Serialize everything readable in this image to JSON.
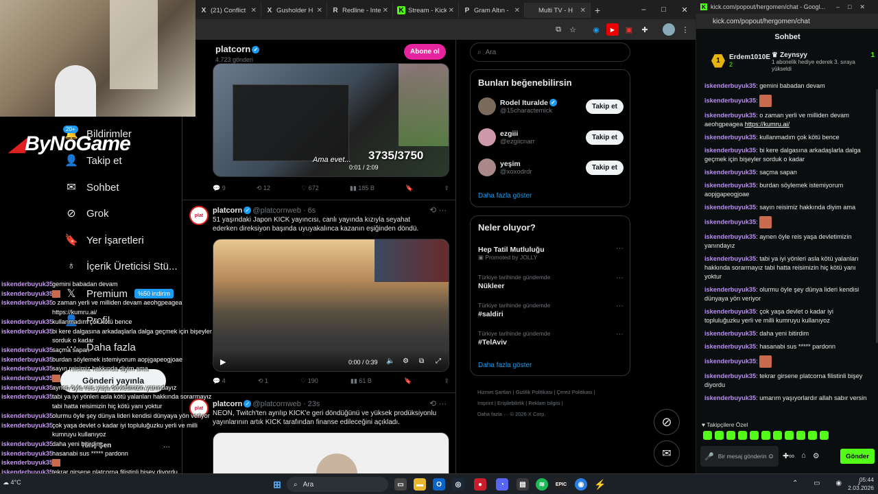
{
  "browser": {
    "tabs": [
      {
        "label": "",
        "icon": "X"
      },
      {
        "label": "",
        "icon": "X"
      },
      {
        "label": "",
        "icon": "X"
      },
      {
        "label": "(21) Conflict",
        "icon": "X"
      },
      {
        "label": "Gusholder H",
        "icon": "X"
      },
      {
        "label": "Redline - Inte",
        "icon": "R"
      },
      {
        "label": "Stream - Kick",
        "icon": "K"
      },
      {
        "label": "Gram Altın -",
        "icon": "P"
      },
      {
        "label": "Multi TV - H",
        "icon": ""
      }
    ],
    "new_tab": "+",
    "window_controls": [
      "–",
      "□",
      "✕"
    ]
  },
  "xnav": {
    "items": [
      {
        "label": "Bildirimler",
        "icon": "bell-icon",
        "glyph": "🔔"
      },
      {
        "label": "Takip et",
        "icon": "add-user-icon",
        "glyph": "👤"
      },
      {
        "label": "Sohbet",
        "icon": "mail-icon",
        "glyph": "✉"
      },
      {
        "label": "Grok",
        "icon": "grok-icon",
        "glyph": "⊘"
      },
      {
        "label": "Yer İşaretleri",
        "icon": "bookmark-icon",
        "glyph": "🔖"
      },
      {
        "label": "İçerik Üreticisi Stü...",
        "icon": "creator-icon",
        "glyph": "♁"
      },
      {
        "label": "Premium",
        "icon": "x-logo-icon",
        "glyph": "𝕏"
      },
      {
        "label": "Profil",
        "icon": "profile-icon",
        "glyph": "👤"
      },
      {
        "label": "Daha fazla",
        "icon": "more-icon",
        "glyph": "⋯"
      }
    ],
    "premium_badge": "%50 indirim",
    "notif_badge": "20+",
    "post_button": "Gönderi yayınla",
    "account_name": "Tunç Şen",
    "account_more": "···"
  },
  "bynogame": {
    "logo_text": "ByNoGame"
  },
  "feed": {
    "top_post": {
      "name": "platcorn",
      "posts_count": "4.723 gönderi",
      "subscribe": "Abone ol",
      "video_caption": "Ama evet...",
      "video_time": "0:01 / 2:09",
      "goal": "3735/3750",
      "stats": {
        "replies": "9",
        "reposts": "12",
        "likes": "672",
        "views": "185 B"
      }
    },
    "post2": {
      "name": "platcorn",
      "handle": "@platcornweb · 6s",
      "text": "51 yaşındaki Japon KICK yayıncısı, canlı yayında kızıyla seyahat ederken direksiyon başında uyuyakalınca kazanın eşiğinden döndü.",
      "video_time": "0:00 / 0:39",
      "stats": {
        "replies": "4",
        "reposts": "1",
        "likes": "190",
        "views": "61 B"
      }
    },
    "post3": {
      "name": "platcorn",
      "handle": "@platcornweb · 23s",
      "text": "NEON, Twitch'ten ayrılıp KICK'e geri döndüğünü ve yüksek prodüksiyonlu yayınlarının artık KICK tarafından finanse edileceğini açıkladı."
    }
  },
  "right": {
    "search_placeholder": "Ara",
    "suggest_title": "Bunları beğenebilirsin",
    "suggestions": [
      {
        "name": "Rodel Ituralde",
        "handle": "@15charactemick",
        "button": "Takip et"
      },
      {
        "name": "ezgiii",
        "handle": "@ezgiicnarr",
        "button": "Takip et"
      },
      {
        "name": "yeşim",
        "handle": "@xoxodrdr",
        "button": "Takip et"
      }
    ],
    "show_more": "Daha fazla göster",
    "trends_title": "Neler oluyor?",
    "trends": [
      {
        "context": "",
        "name": "Hep Tatil Mutluluğu",
        "promoted": "Promoted by JOLLY"
      },
      {
        "context": "Türkiye tarihinde gündemde",
        "name": "Nükleer"
      },
      {
        "context": "Türkiye tarihinde gündemde",
        "name": "#saldiri"
      },
      {
        "context": "Türkiye tarihinde gündemde",
        "name": "#TelAviv"
      }
    ],
    "trends_more": "Daha fazla göster",
    "footer": [
      "Hizmet Şartları",
      "Gizlilik Politikası",
      "Çerez Politikası",
      "Imprint",
      "Erişilebilirlik",
      "Reklam bilgisi",
      "Daha fazla ···",
      "© 2026 X Corp."
    ]
  },
  "kick": {
    "url": "kick.com/popout/hergomen/chat",
    "window_title": "kick.com/popout/hergomen/chat - Googl...",
    "header": "Sohbet",
    "top_gifter": {
      "name": "Erdem1010E",
      "count": "2"
    },
    "pinned": {
      "name": "Zeynsyy",
      "count": "1",
      "text": "1 abonelik hediye ederek 3. sıraya yükseldi"
    },
    "messages": [
      {
        "user": "iskenderbuyuk35",
        "text": "gemini babadan devam"
      },
      {
        "user": "iskenderbuyuk35",
        "text": "",
        "emote": true
      },
      {
        "user": "iskenderbuyuk35",
        "text": "o zaman yerli ve milliden devam aeohgpeagea",
        "link": "https://kumru.ai/"
      },
      {
        "user": "iskenderbuyuk35",
        "text": "kullanmadım çok kötü bence"
      },
      {
        "user": "iskenderbuyuk35",
        "text": "bi kere dalgasına arkadaşlarla dalga geçmek için bişeyler sorduk o kadar"
      },
      {
        "user": "iskenderbuyuk35",
        "text": "saçma sapan"
      },
      {
        "user": "iskenderbuyuk35",
        "text": "burdan söylemek istemiyorum aopjgapeogjoae"
      },
      {
        "user": "iskenderbuyuk35",
        "text": "sayın reisimiz hakkında diyim ama"
      },
      {
        "user": "iskenderbuyuk35",
        "text": "",
        "emote": true
      },
      {
        "user": "iskenderbuyuk35",
        "text": "aynen öyle reis yaşa devletimizin yanındayız"
      },
      {
        "user": "iskenderbuyuk35",
        "text": "tabi ya iyi yönleri asla kötü yalanları hakkında sorarmayız tabi hatta reisimizin hiç kötü yanı yoktur"
      },
      {
        "user": "iskenderbuyuk35",
        "text": "olurmu öyle şey dünya lideri kendisi dünyaya yön veriyor"
      },
      {
        "user": "iskenderbuyuk35",
        "text": "çok yaşa devlet o kadar iyi topluluğuzku yerli ve milli kumruyu kullanıyoz"
      },
      {
        "user": "iskenderbuyuk35",
        "text": "daha yeni bitirdim"
      },
      {
        "user": "iskenderbuyuk35",
        "text": "hasanabi sus ***** pardonn"
      },
      {
        "user": "iskenderbuyuk35",
        "text": "",
        "emote": true
      },
      {
        "user": "iskenderbuyuk35",
        "text": "tekrar girsene platcorna filistinli bişey diyordu"
      },
      {
        "user": "iskenderbuyuk35",
        "text": "umarım yaşıyorlardır allah sabır versin"
      }
    ],
    "followers_only": "Takipçilere Özel",
    "input_placeholder": "Bir mesaj gönderin",
    "send": "Gönder"
  },
  "overlay": {
    "lines": [
      {
        "user": "iskenderbuyuk35",
        "text": "gemini babadan devam"
      },
      {
        "user": "iskenderbuyuk35",
        "text": ""
      },
      {
        "user": "iskenderbuyuk35",
        "text": "o zaman yerli ve milliden devam aeohgpeagea"
      },
      {
        "user": "",
        "text": "https://kumru.ai/"
      },
      {
        "user": "iskenderbuyuk35",
        "text": "kullanmadım çok kötü bence"
      },
      {
        "user": "iskenderbuyuk35",
        "text": "bi kere dalgasına arkadaşlarla dalga geçmek için bişeyler"
      },
      {
        "user": "",
        "text": "sorduk o kadar"
      },
      {
        "user": "iskenderbuyuk35",
        "text": "saçma sapan"
      },
      {
        "user": "iskenderbuyuk35",
        "text": "burdan söylemek istemiyorum aopjgapeogjoae"
      },
      {
        "user": "iskenderbuyuk35",
        "text": "sayın reisimiz hakkında diyim ama"
      },
      {
        "user": "iskenderbuyuk35",
        "text": ""
      },
      {
        "user": "iskenderbuyuk35",
        "text": "aynen öyle reis yaşa devletimizin yanındayız"
      },
      {
        "user": "iskenderbuyuk35",
        "text": "tabi ya iyi yönleri asla kötü yalanları hakkında sorarmayız"
      },
      {
        "user": "",
        "text": "tabi hatta reisimizin hiç kötü yanı yoktur"
      },
      {
        "user": "iskenderbuyuk35",
        "text": "olurmu öyle şey dünya lideri kendisi dünyaya yön veriyor"
      },
      {
        "user": "iskenderbuyuk35",
        "text": "çok yaşa devlet o kadar iyi topluluğuzku yerli ve milli"
      },
      {
        "user": "",
        "text": "kumruyu kullanıyoz"
      },
      {
        "user": "iskenderbuyuk35",
        "text": "daha yeni bitirdim"
      },
      {
        "user": "iskenderbuyuk35",
        "text": "hasanabi sus ***** pardonn"
      },
      {
        "user": "iskenderbuyuk35",
        "text": ""
      },
      {
        "user": "iskenderbuyuk35",
        "text": "tekrar girsene platcorna filistinli bişey diyordu"
      },
      {
        "user": "iskenderbuyuk35",
        "text": "umarım yaşıyorlardır allah sabır versin"
      }
    ]
  },
  "taskbar": {
    "search": "Ara",
    "weather": "4°C",
    "time": "05:44",
    "date": "2.03.2026"
  },
  "colors": {
    "kick_green": "#53fc18",
    "x_blue": "#1d9bf0",
    "kick_user": "#b98ef5",
    "subscribe_pink": "#e6249d"
  }
}
